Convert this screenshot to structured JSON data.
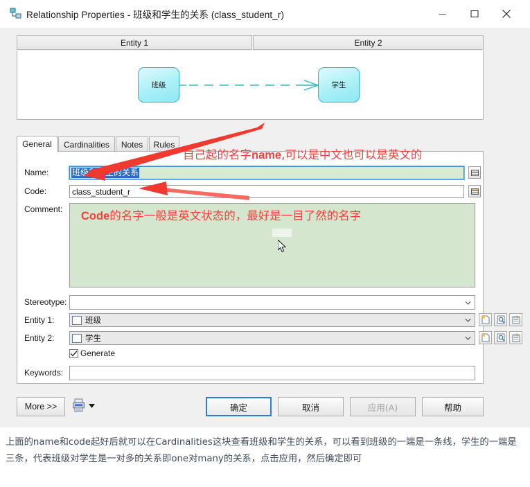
{
  "window": {
    "title": "Relationship Properties - 班级和学生的关系 (class_student_r)",
    "icon": "relationship-icon",
    "minimize_label": "—",
    "maximize_label": "▢",
    "close_label": "✕"
  },
  "preview": {
    "header_entity1": "Entity 1",
    "header_entity2": "Entity 2",
    "entity1_name": "班级",
    "entity2_name": "学生",
    "connector": "dashed line with crow's foot on Entity 2 side"
  },
  "tabs": [
    {
      "label": "General",
      "selected": true
    },
    {
      "label": "Cardinalities",
      "selected": false
    },
    {
      "label": "Notes",
      "selected": false
    },
    {
      "label": "Rules",
      "selected": false
    }
  ],
  "form": {
    "name_label": "Name:",
    "name_value": "班级和学生的关系",
    "code_label": "Code:",
    "code_value": "class_student_r",
    "comment_label": "Comment:",
    "comment_value": "",
    "stereotype_label": "Stereotype:",
    "stereotype_value": "",
    "entity1_label": "Entity 1:",
    "entity1_value": "班级",
    "entity2_label": "Entity 2:",
    "entity2_value": "学生",
    "generate_label": "Generate",
    "generate_checked": true,
    "keywords_label": "Keywords:",
    "keywords_value": "",
    "ellipsis_button_icon": "properties-list-icon",
    "new_icon": "new-document-icon",
    "browse_icon": "magnifier-browse-icon",
    "properties_icon": "properties-window-icon",
    "dropdown_icon": "chevron-down-icon"
  },
  "buttons": {
    "more": "More >>",
    "print_icon": "printer-icon",
    "print_dropdown_icon": "caret-down-icon",
    "ok": "确定",
    "cancel": "取消",
    "apply": "应用(A)",
    "help": "帮助"
  },
  "annotations": {
    "name_note_prefix": "自己起的名字",
    "name_note_bold": "name",
    "name_note_suffix": ",可以是中文也可以是英文的",
    "comment_note_bold": "Code",
    "comment_note_rest": "的名字一般是英文状态的，最好是一目了然的名字",
    "color": "#fa3c3c"
  },
  "caption": {
    "text": "上面的name和code起好后就可以在Cardinalities这块查看班级和学生的关系，可以看到班级的一端是一条线，学生的一端是三条，代表班级对学生是一对多的关系即one对many的关系，点击应用，然后确定即可"
  },
  "colors": {
    "field_highlight": "#d9ead3",
    "comment_bg": "#d4e6cd",
    "selection_blue": "#2a6ccc",
    "focus_blue": "#2a7fd4",
    "entity_fill": "#aaf0f7",
    "entity_border": "#2fb9c4",
    "annotation_red": "#fa3c3c",
    "caption_text": "#3f4a5a"
  }
}
